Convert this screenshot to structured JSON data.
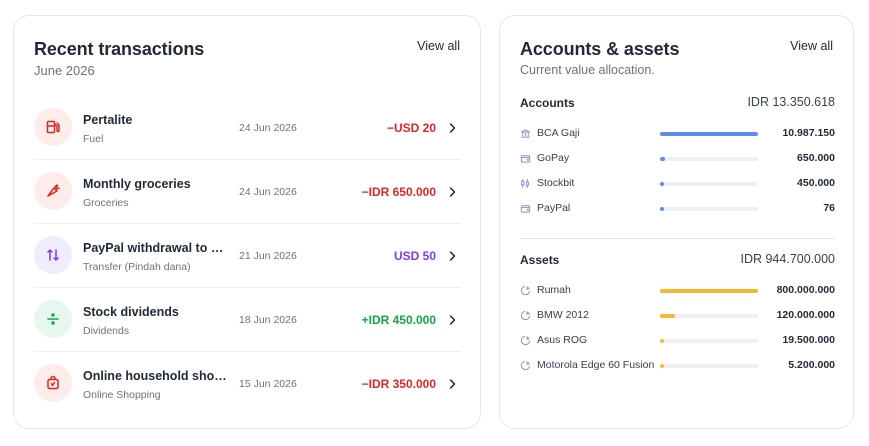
{
  "colors": {
    "expense": "#dc2626",
    "income": "#16a34a",
    "transfer": "#7c3aed",
    "accounts_bar": "#5b8def",
    "assets_bar": "#f5b82e",
    "icon_muted": "#8b93c9"
  },
  "transactions": {
    "title": "Recent transactions",
    "subtitle": "June 2026",
    "view_all": "View all",
    "items": [
      {
        "name": "Pertalite",
        "category": "Fuel",
        "date": "24 Jun 2026",
        "amount": "−USD 20",
        "type": "expense",
        "icon": "fuel-icon",
        "icon_bg": "#fdecea",
        "icon_color": "#dc2626"
      },
      {
        "name": "Monthly groceries",
        "category": "Groceries",
        "date": "24 Jun 2026",
        "amount": "−IDR 650.000",
        "type": "expense",
        "icon": "carrot-icon",
        "icon_bg": "#fdecea",
        "icon_color": "#dc2626"
      },
      {
        "name": "PayPal withdrawal to BCA",
        "category": "Transfer (Pindah dana)",
        "date": "21 Jun 2026",
        "amount": "USD 50",
        "type": "transfer",
        "icon": "transfer-arrows-icon",
        "icon_bg": "#f1ecfd",
        "icon_color": "#7c3aed"
      },
      {
        "name": "Stock dividends",
        "category": "Dividends",
        "date": "18 Jun 2026",
        "amount": "+IDR 450.000",
        "type": "income",
        "icon": "divide-icon",
        "icon_bg": "#e8f7ee",
        "icon_color": "#16a34a"
      },
      {
        "name": "Online household shopping",
        "category": "Online Shopping",
        "date": "15 Jun 2026",
        "amount": "−IDR 350.000",
        "type": "expense",
        "icon": "shopping-bag-icon",
        "icon_bg": "#fdecea",
        "icon_color": "#dc2626"
      }
    ]
  },
  "accounts_assets": {
    "title": "Accounts & assets",
    "subtitle": "Current value allocation.",
    "view_all": "View all",
    "accounts": {
      "label": "Accounts",
      "total": "IDR 13.350.618",
      "items": [
        {
          "name": "BCA Gaji",
          "value": "10.987.150",
          "share": 1.0,
          "icon": "bank-icon"
        },
        {
          "name": "GoPay",
          "value": "650.000",
          "share": 0.05,
          "icon": "wallet-icon"
        },
        {
          "name": "Stockbit",
          "value": "450.000",
          "share": 0.04,
          "icon": "stock-icon"
        },
        {
          "name": "PayPal",
          "value": "76",
          "share": 0.0,
          "icon": "wallet-icon"
        }
      ]
    },
    "assets": {
      "label": "Assets",
      "total": "IDR 944.700.000",
      "items": [
        {
          "name": "Rumah",
          "value": "800.000.000",
          "share": 1.0,
          "icon": "pie-chart-icon"
        },
        {
          "name": "BMW 2012",
          "value": "120.000.000",
          "share": 0.15,
          "icon": "pie-chart-icon"
        },
        {
          "name": "Asus ROG",
          "value": "19.500.000",
          "share": 0.02,
          "icon": "pie-chart-icon"
        },
        {
          "name": "Motorola Edge 60 Fusion",
          "value": "5.200.000",
          "share": 0.0,
          "icon": "pie-chart-icon"
        }
      ]
    }
  }
}
